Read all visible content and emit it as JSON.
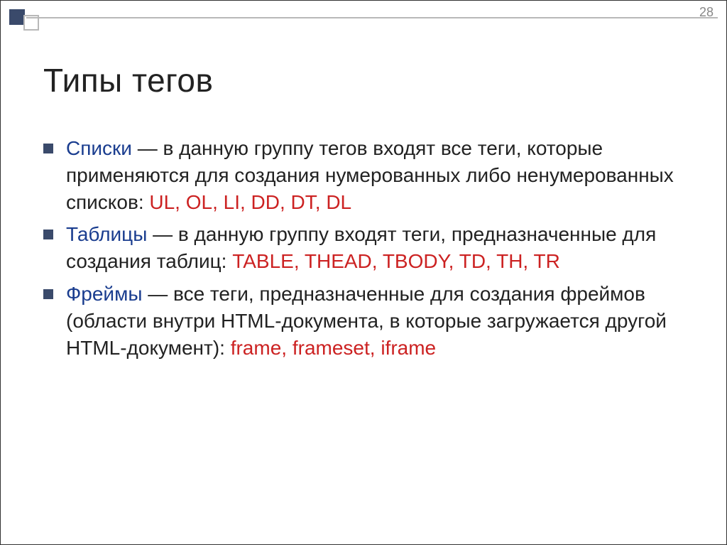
{
  "page_number": "28",
  "slide_title": "Типы тегов",
  "bullets": [
    {
      "term": "Списки",
      "description_before": " — в данную группу тегов входят все теги, которые применяются для создания нумерованных либо ненумерованных списков: ",
      "tags": "UL, OL, LI, DD, DT, DL",
      "description_after": ""
    },
    {
      "term": "Таблицы",
      "description_before": " — в данную группу входят теги, предназначенные для создания таблиц: ",
      "tags": "TABLE, THEAD, TBODY, TD, TH, TR",
      "description_after": ""
    },
    {
      "term": "Фреймы",
      "description_before": " — все теги, предназначенные для создания фреймов (области внутри HTML-документа, в которые загружается другой HTML-документ): ",
      "tags": "frame, frameset, iframe",
      "description_after": ""
    }
  ]
}
